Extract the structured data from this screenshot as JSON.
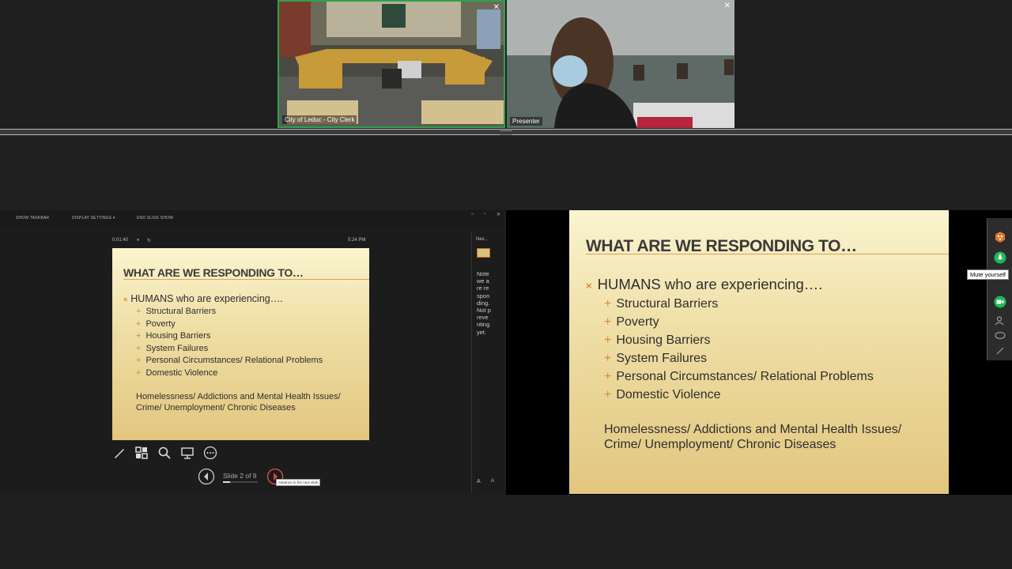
{
  "videos": {
    "room": {
      "label": "City of Leduc - City Clerk",
      "close": "✕"
    },
    "presenter": {
      "label": "Presenter",
      "close": "✕"
    }
  },
  "presenter_view": {
    "toolbar": {
      "show_taskbar": "SHOW TASKBAR",
      "display_settings": "DISPLAY SETTINGS ▾",
      "end_slide_show": "END SLIDE SHOW"
    },
    "window_controls": [
      "–",
      "▫",
      "✕"
    ],
    "timer": "0:01:40",
    "clock": "5:24 PM",
    "pause_glyph": "⏸",
    "reset_glyph": "↻",
    "next_label": "Nex..",
    "notes": "Note we are responding. Not preventing yet.",
    "slide_counter": "Slide 2 of 9",
    "next_tooltip": "Advance to the next slide",
    "zoom_in": "A",
    "zoom_out": "A"
  },
  "slide": {
    "title": "WHAT ARE WE RESPONDING TO…",
    "main_bullet": "HUMANS who are experiencing….",
    "main_bullet_glyph": "×",
    "sub_bullet_glyph": "+",
    "sub_bullets": [
      "Structural Barriers",
      "Poverty",
      "Housing Barriers",
      "System Failures",
      "Personal Circumstances/ Relational Problems",
      "Domestic Violence"
    ],
    "footer_line1": "Homelessness/ Addictions and Mental Health Issues/",
    "footer_line2": "Crime/ Unemployment/ Chronic Diseases"
  },
  "side_toolbar": {
    "mute_tooltip": "Mute yourself",
    "colors": {
      "green": "#1db954",
      "orange": "#e8762b"
    }
  }
}
